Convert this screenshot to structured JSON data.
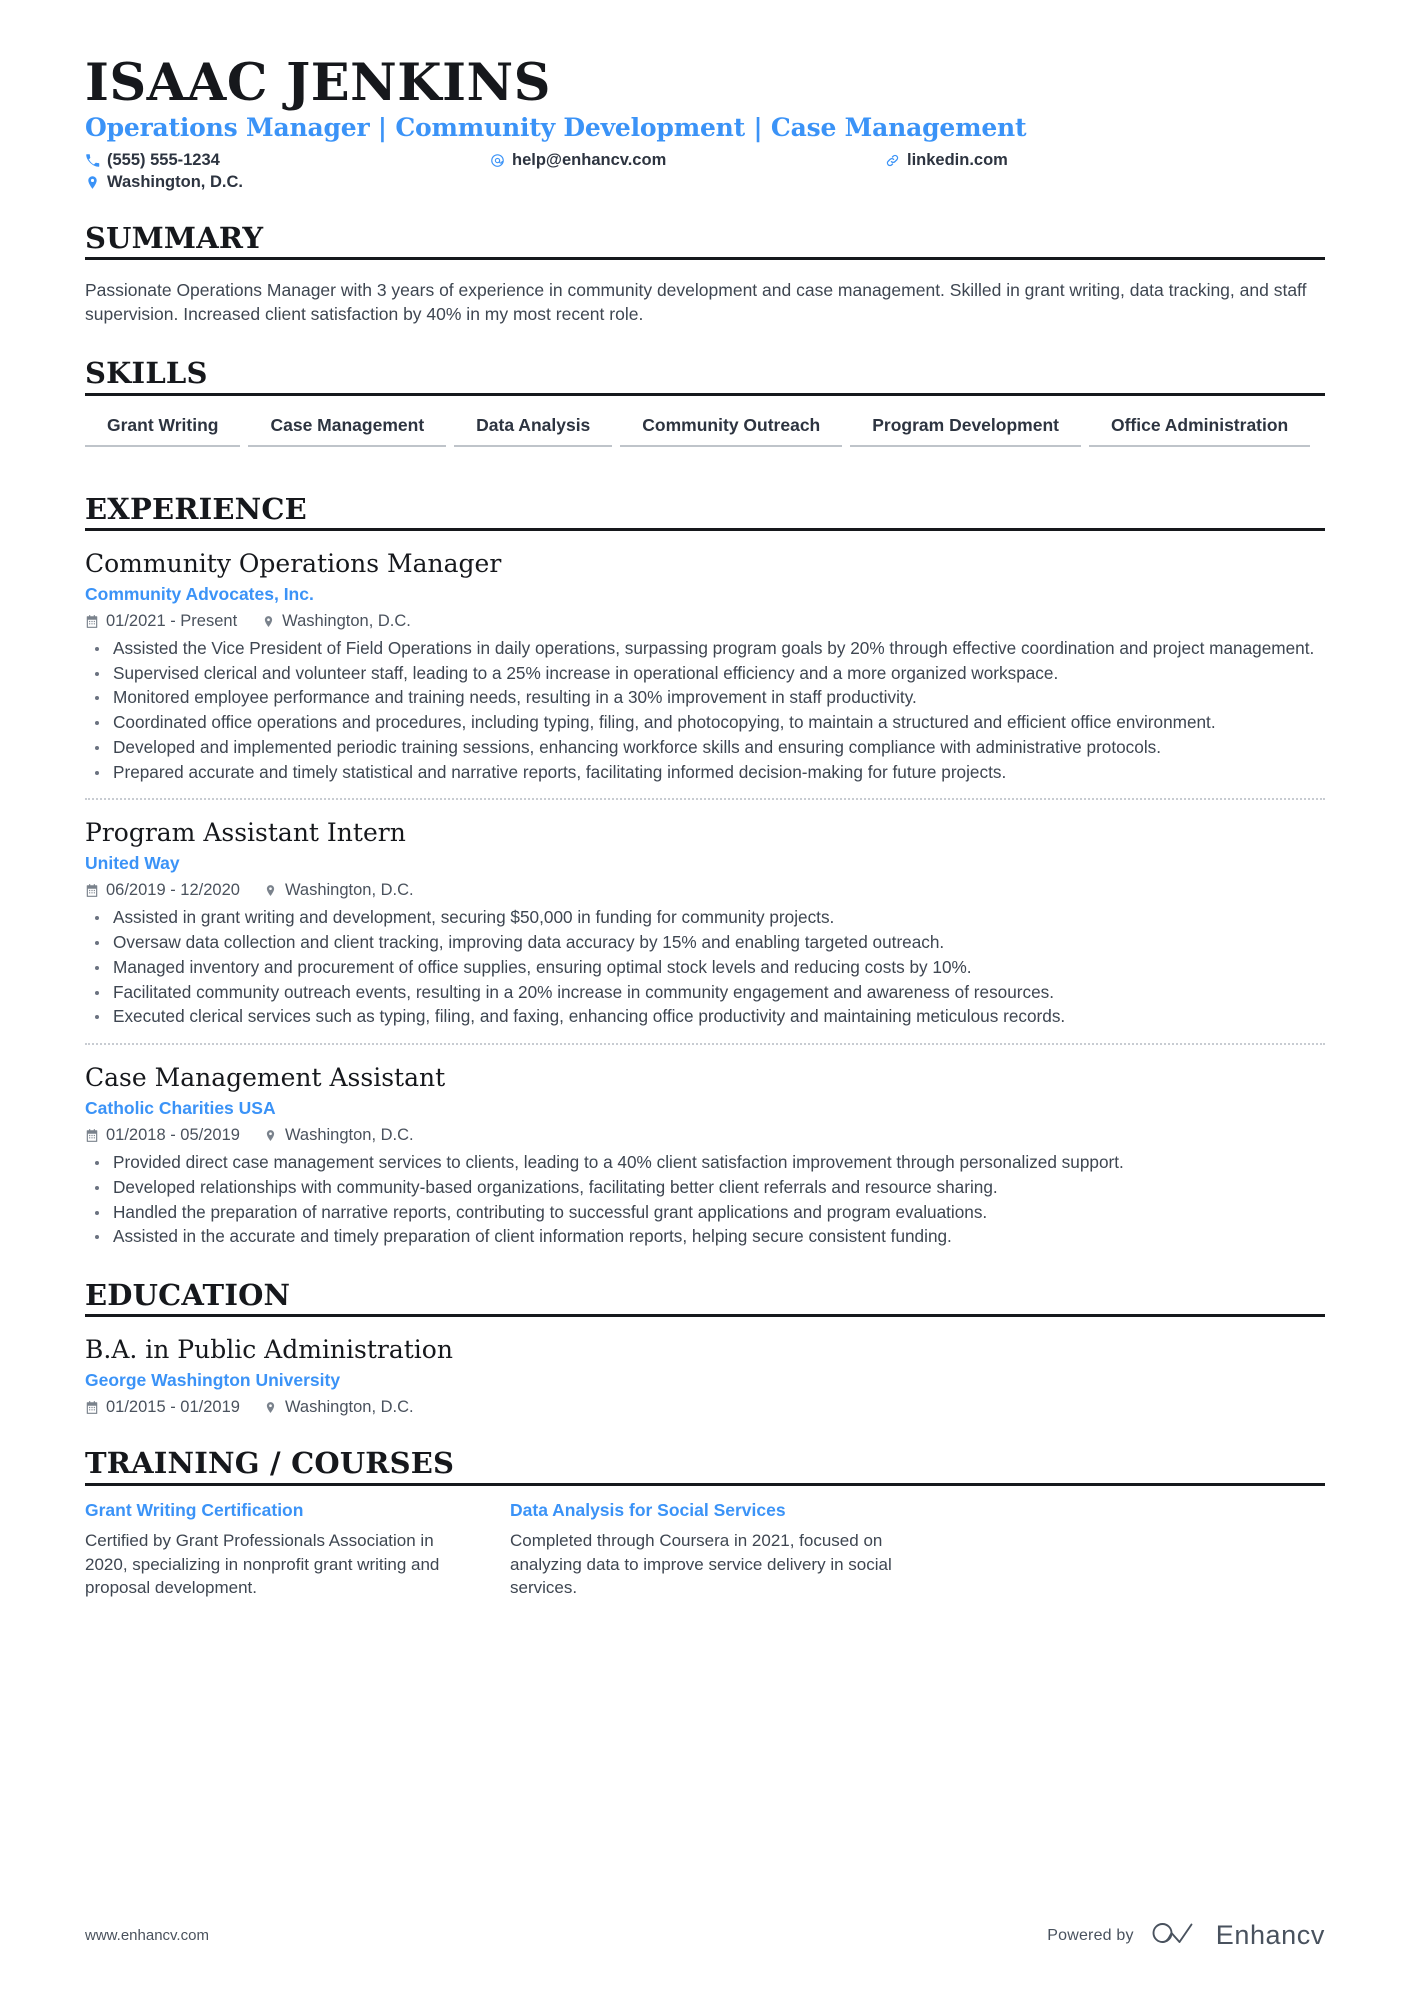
{
  "header": {
    "name": "ISAAC JENKINS",
    "headline": "Operations Manager | Community Development | Case Management",
    "contacts": [
      {
        "icon": "phone-icon",
        "text": "(555) 555-1234"
      },
      {
        "icon": "email-icon",
        "text": "help@enhancv.com"
      },
      {
        "icon": "link-icon",
        "text": "linkedin.com"
      },
      {
        "icon": "location-icon",
        "text": "Washington, D.C."
      }
    ]
  },
  "summary": {
    "title": "SUMMARY",
    "text": "Passionate Operations Manager with 3 years of experience in community development and case management. Skilled in grant writing, data tracking, and staff supervision. Increased client satisfaction by 40% in my most recent role."
  },
  "skills": {
    "title": "SKILLS",
    "items": [
      "Grant Writing",
      "Case Management",
      "Data Analysis",
      "Community Outreach",
      "Program Development",
      "Office Administration"
    ]
  },
  "experience": {
    "title": "EXPERIENCE",
    "entries": [
      {
        "role": "Community Operations Manager",
        "company": "Community Advocates, Inc.",
        "dates": "01/2021 - Present",
        "location": "Washington, D.C.",
        "bullets": [
          "Assisted the Vice President of Field Operations in daily operations, surpassing program goals by 20% through effective coordination and project management.",
          "Supervised clerical and volunteer staff, leading to a 25% increase in operational efficiency and a more organized workspace.",
          "Monitored employee performance and training needs, resulting in a 30% improvement in staff productivity.",
          "Coordinated office operations and procedures, including typing, filing, and photocopying, to maintain a structured and efficient office environment.",
          "Developed and implemented periodic training sessions, enhancing workforce skills and ensuring compliance with administrative protocols.",
          "Prepared accurate and timely statistical and narrative reports, facilitating informed decision-making for future projects."
        ]
      },
      {
        "role": "Program Assistant Intern",
        "company": "United Way",
        "dates": "06/2019 - 12/2020",
        "location": "Washington, D.C.",
        "bullets": [
          "Assisted in grant writing and development, securing $50,000 in funding for community projects.",
          "Oversaw data collection and client tracking, improving data accuracy by 15% and enabling targeted outreach.",
          "Managed inventory and procurement of office supplies, ensuring optimal stock levels and reducing costs by 10%.",
          "Facilitated community outreach events, resulting in a 20% increase in community engagement and awareness of resources.",
          "Executed clerical services such as typing, filing, and faxing, enhancing office productivity and maintaining meticulous records."
        ]
      },
      {
        "role": "Case Management Assistant",
        "company": "Catholic Charities USA",
        "dates": "01/2018 - 05/2019",
        "location": "Washington, D.C.",
        "bullets": [
          "Provided direct case management services to clients, leading to a 40% client satisfaction improvement through personalized support.",
          "Developed relationships with community-based organizations, facilitating better client referrals and resource sharing.",
          "Handled the preparation of narrative reports, contributing to successful grant applications and program evaluations.",
          "Assisted in the accurate and timely preparation of client information reports, helping secure consistent funding."
        ]
      }
    ]
  },
  "education": {
    "title": "EDUCATION",
    "entries": [
      {
        "degree": "B.A. in Public Administration",
        "school": "George Washington University",
        "dates": "01/2015 - 01/2019",
        "location": "Washington, D.C."
      }
    ]
  },
  "training": {
    "title": "TRAINING / COURSES",
    "courses": [
      {
        "name": "Grant Writing Certification",
        "description": "Certified by Grant Professionals Association in 2020, specializing in nonprofit grant writing and proposal development."
      },
      {
        "name": "Data Analysis for Social Services",
        "description": "Completed through Coursera in 2021, focused on analyzing data to improve service delivery in social services."
      }
    ]
  },
  "footer": {
    "url": "www.enhancv.com",
    "powered_by": "Powered by",
    "brand": "Enhancv"
  },
  "colors": {
    "accent": "#3b93f7",
    "ink": "#16181c",
    "body": "#3e4651",
    "rule": "#16181c",
    "tag_underline": "#bfc4ca"
  }
}
